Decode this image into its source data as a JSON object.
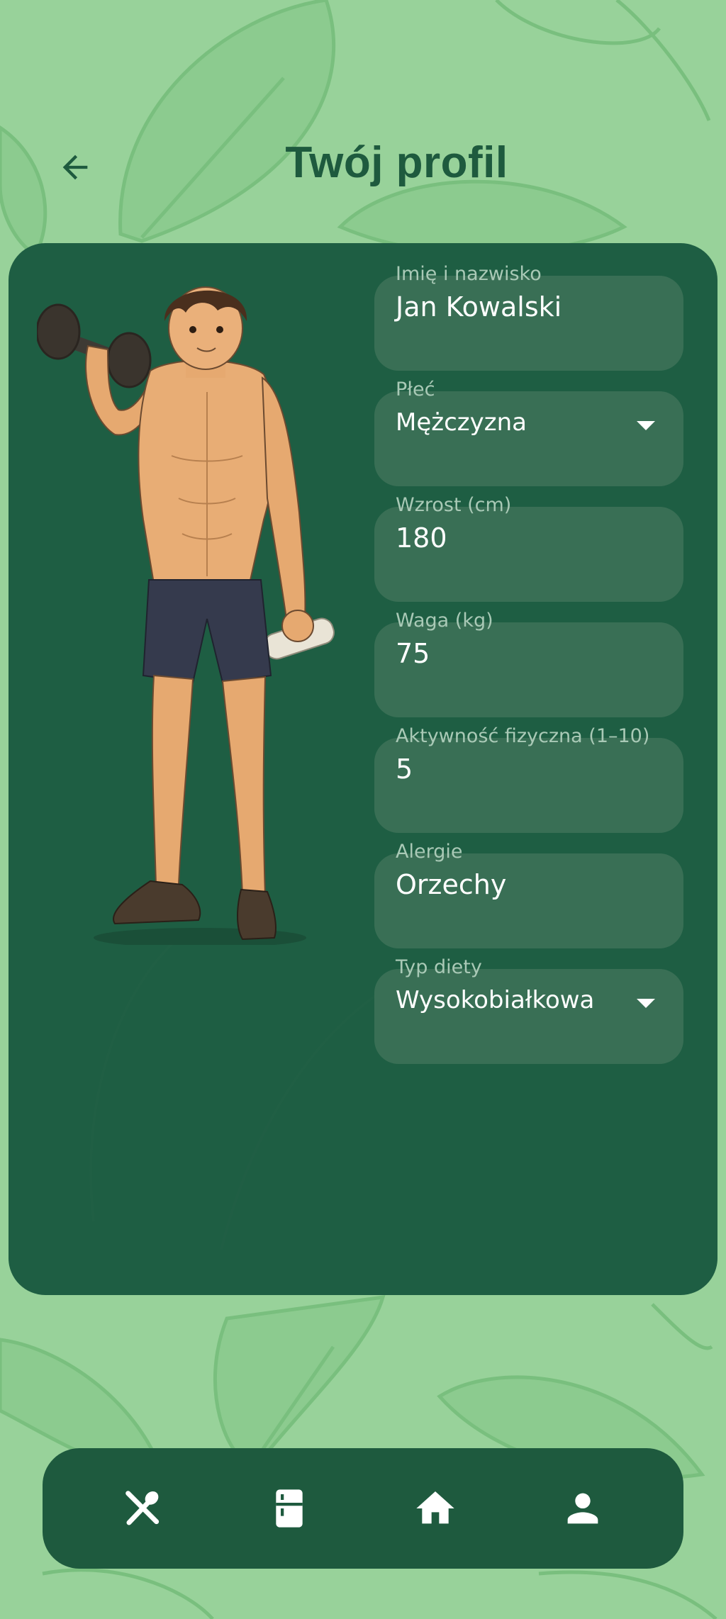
{
  "header": {
    "title": "Twój profil",
    "back_icon": "arrow-left-icon"
  },
  "profile": {
    "illustration": "fitness-man-illustration",
    "fields": [
      {
        "label": "Imię i nazwisko",
        "value": "Jan Kowalski",
        "type": "text"
      },
      {
        "label": "Płeć",
        "value": "Mężczyzna",
        "type": "dropdown"
      },
      {
        "label": "Wzrost (cm)",
        "value": "180",
        "type": "number"
      },
      {
        "label": "Waga (kg)",
        "value": "75",
        "type": "number"
      },
      {
        "label": "Aktywność fizyczna (1–10)",
        "value": "5",
        "type": "number"
      },
      {
        "label": "Alergie",
        "value": "Orzechy",
        "type": "text"
      },
      {
        "label": "Typ diety",
        "value": "Wysokobiałkowa",
        "type": "dropdown"
      }
    ]
  },
  "bottom_nav": {
    "items": [
      {
        "icon": "restaurant-icon"
      },
      {
        "icon": "fridge-icon"
      },
      {
        "icon": "home-icon"
      },
      {
        "icon": "person-icon"
      }
    ]
  },
  "colors": {
    "background": "#98d29a",
    "card": "#1e5e43",
    "field": "#396f55",
    "title": "#1e5a3e",
    "nav": "#1e5a3e"
  }
}
